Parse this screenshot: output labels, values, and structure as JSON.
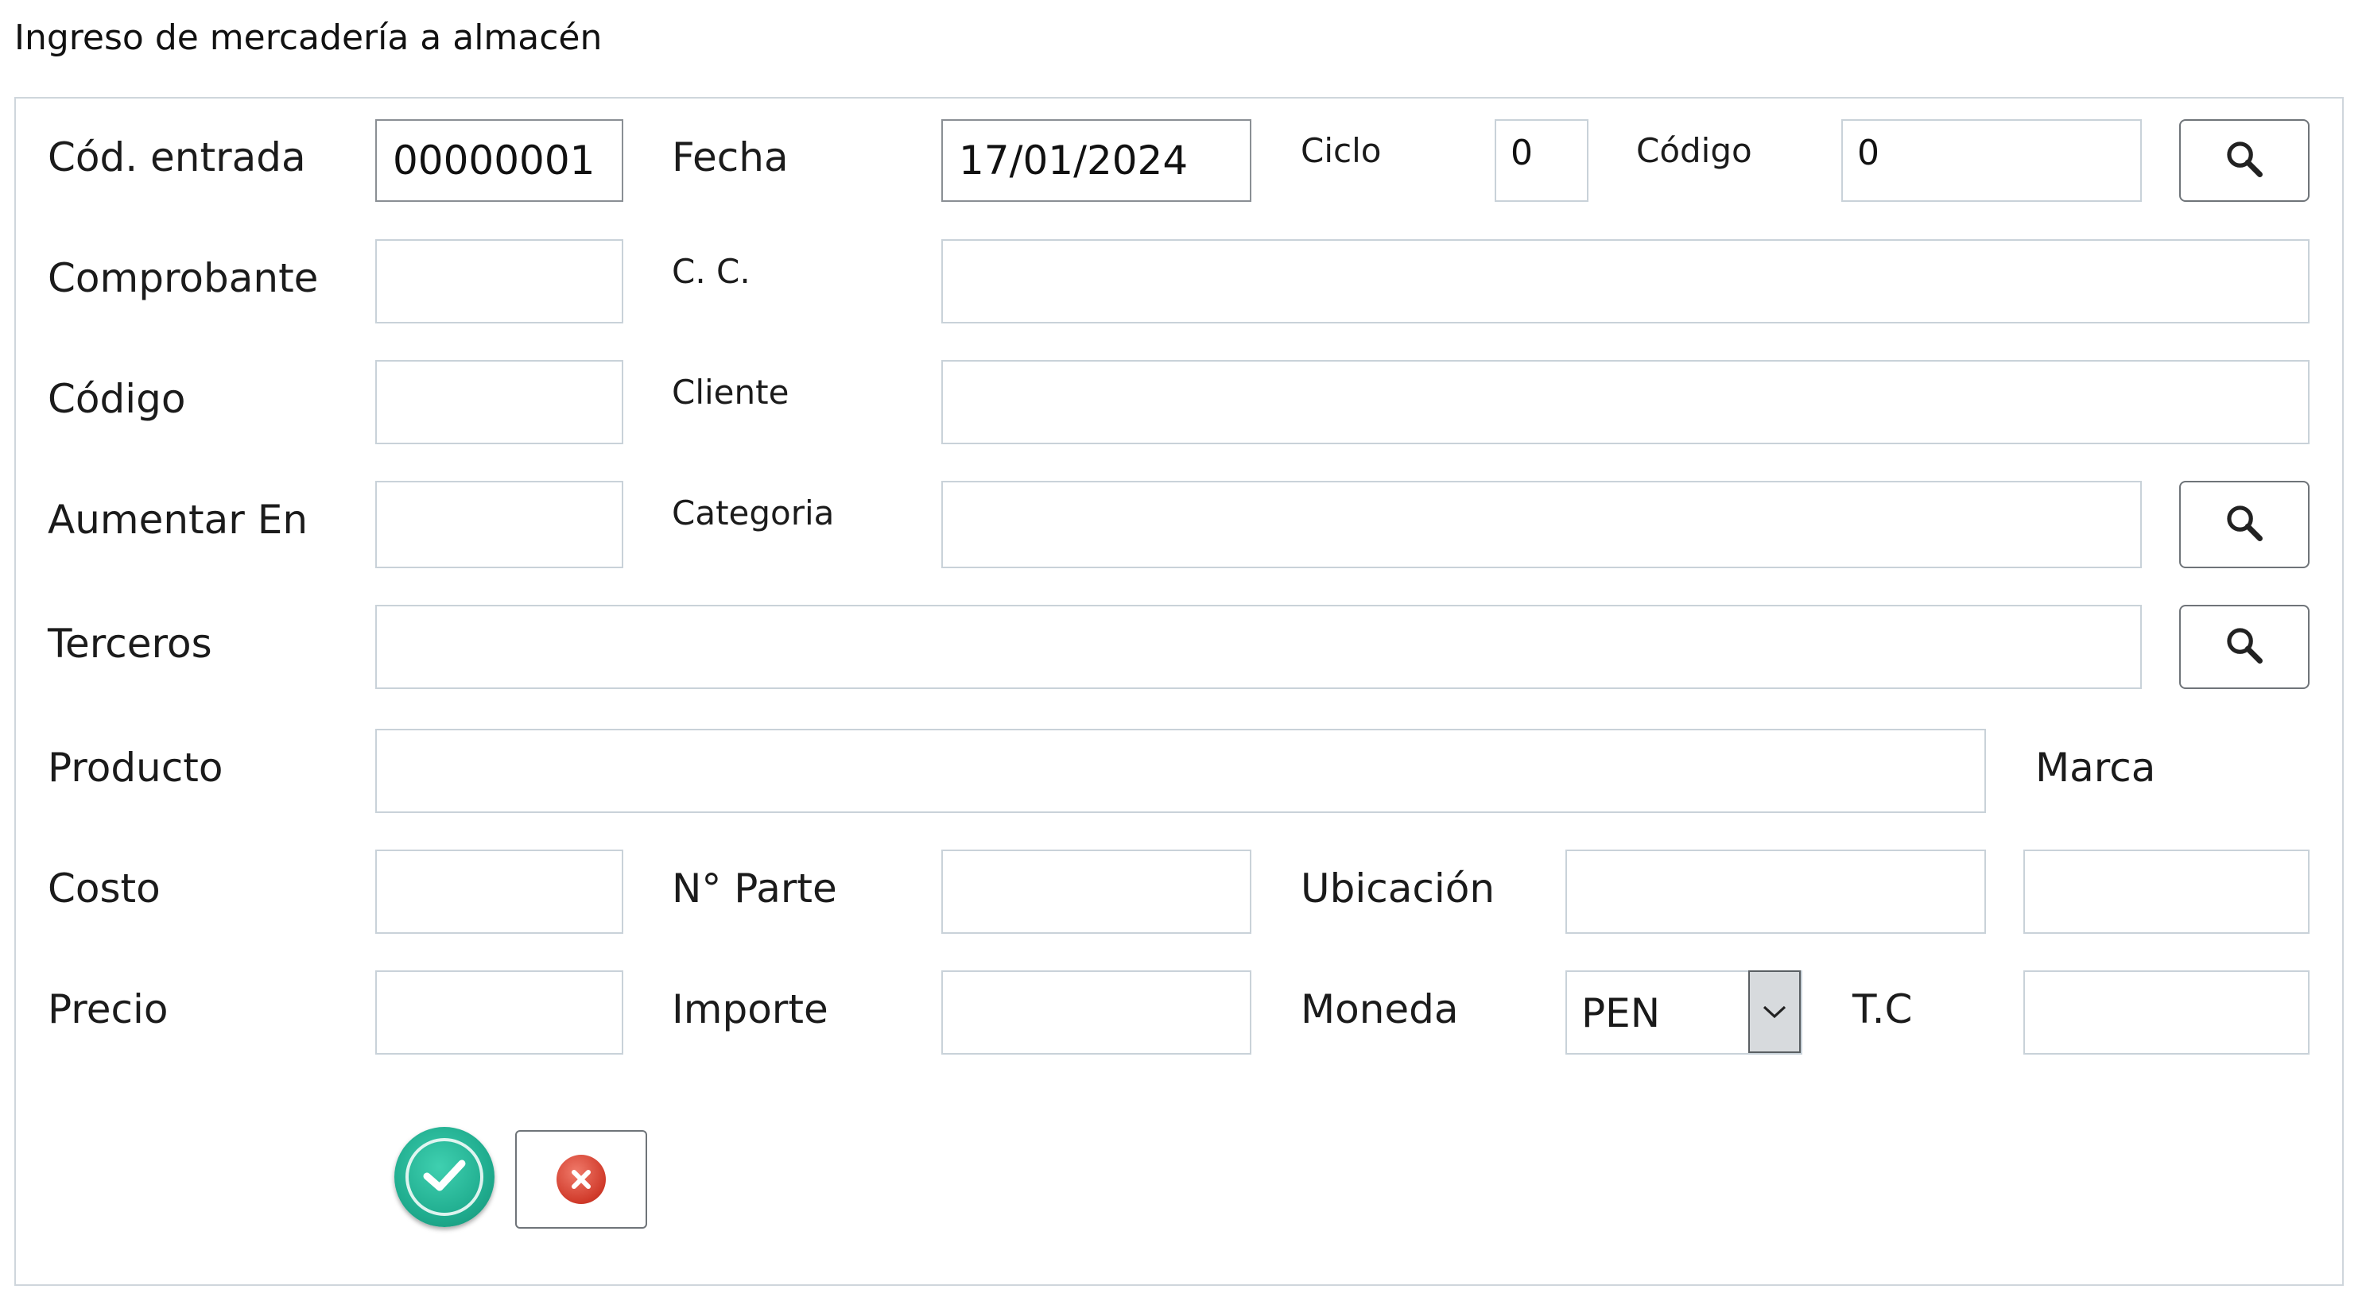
{
  "window": {
    "title": "Ingreso de mercadería a almacén"
  },
  "form": {
    "cod_entrada": {
      "label": "Cód. entrada",
      "value": "00000001"
    },
    "fecha": {
      "label": "Fecha",
      "value": "17/01/2024"
    },
    "ciclo": {
      "label": "Ciclo",
      "value": "0"
    },
    "codigo_top": {
      "label": "Código",
      "value": "0"
    },
    "comprobante": {
      "label": "Comprobante",
      "value": ""
    },
    "cc": {
      "label": "C. C.",
      "value": ""
    },
    "codigo": {
      "label": "Código",
      "value": ""
    },
    "cliente": {
      "label": "Cliente",
      "value": ""
    },
    "aumentar_en": {
      "label": "Aumentar En",
      "value": ""
    },
    "categoria": {
      "label": "Categoria",
      "value": ""
    },
    "terceros": {
      "label": "Terceros",
      "value": ""
    },
    "producto": {
      "label": "Producto",
      "value": ""
    },
    "marca": {
      "label": "Marca",
      "value": ""
    },
    "costo": {
      "label": "Costo",
      "value": ""
    },
    "n_parte": {
      "label": "N° Parte",
      "value": ""
    },
    "ubicacion": {
      "label": "Ubicación",
      "value": ""
    },
    "precio": {
      "label": "Precio",
      "value": ""
    },
    "importe": {
      "label": "Importe",
      "value": ""
    },
    "moneda": {
      "label": "Moneda",
      "value": "PEN"
    },
    "tc": {
      "label": "T.C",
      "value": ""
    }
  },
  "icons": {
    "search": "search-icon",
    "dropdown": "chevron-down-icon",
    "confirm": "check-circle-icon",
    "cancel": "close-circle-icon"
  },
  "colors": {
    "confirm": "#20ad8f",
    "cancel": "#d03a2a",
    "border": "#c9d2d9"
  }
}
